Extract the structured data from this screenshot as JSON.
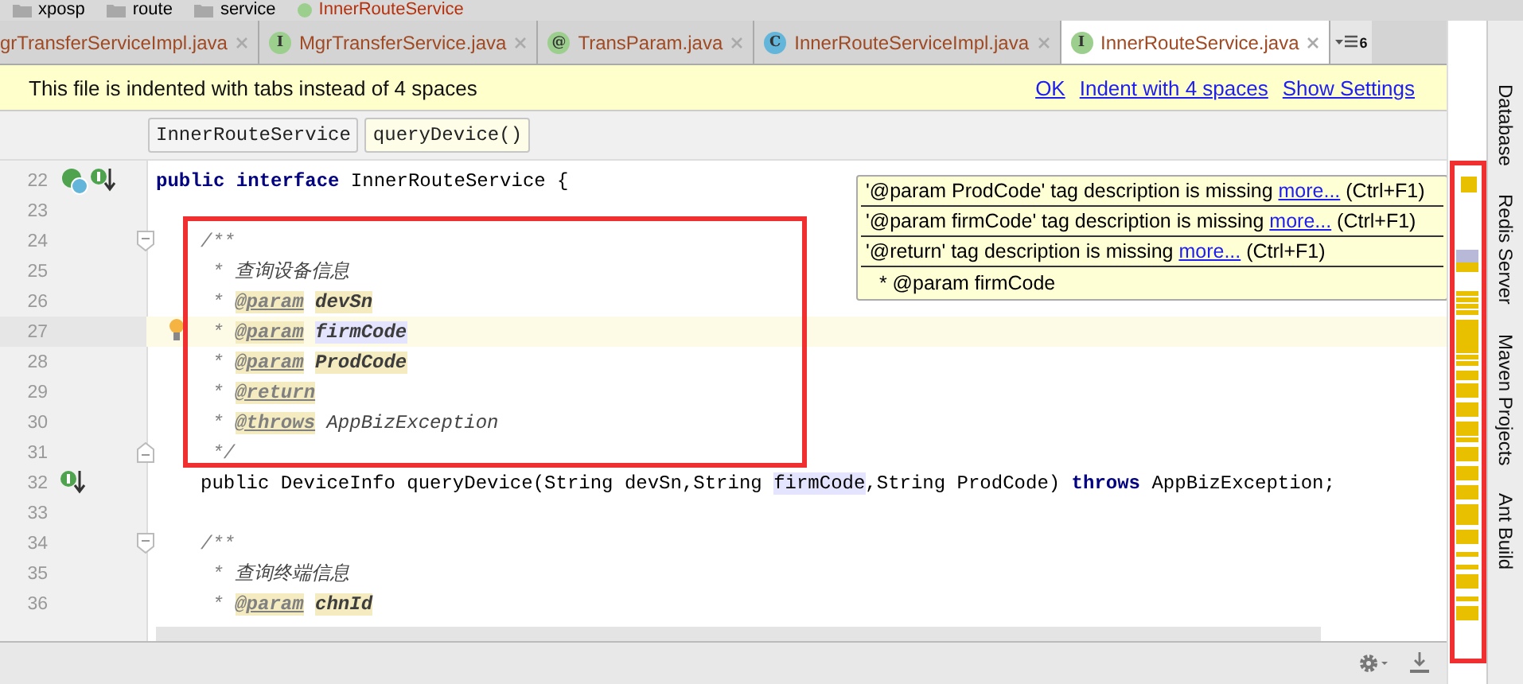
{
  "navigation_bar": {
    "items": [
      {
        "label": "xposp",
        "kind": "folder"
      },
      {
        "label": "route",
        "kind": "folder"
      },
      {
        "label": "service",
        "kind": "folder"
      },
      {
        "label": "InnerRouteService",
        "kind": "interface"
      }
    ]
  },
  "tabs": [
    {
      "label": "grTransferServiceImpl.java",
      "selected": false
    },
    {
      "label": "MgrTransferService.java",
      "kind": "interface",
      "icon_text": "I",
      "selected": false
    },
    {
      "label": "TransParam.java",
      "kind": "annotation",
      "icon_text": "@",
      "selected": false
    },
    {
      "label": "InnerRouteServiceImpl.java",
      "kind": "class",
      "icon_text": "C",
      "selected": false
    },
    {
      "label": "InnerRouteService.java",
      "kind": "interface",
      "icon_text": "I",
      "selected": true
    }
  ],
  "tab_overflow": {
    "count": "6"
  },
  "notification": {
    "message": "This file is indented with tabs instead of 4 spaces",
    "actions": [
      "OK",
      "Indent with 4 spaces",
      "Show Settings"
    ]
  },
  "breadcrumbs": [
    {
      "label": "InnerRouteService",
      "selected": false
    },
    {
      "label": "queryDevice()",
      "selected": true
    }
  ],
  "editor": {
    "lines": [
      {
        "number": "22",
        "gutter": [
          {
            "kind": "implemented"
          },
          {
            "kind": "overriding"
          }
        ],
        "current": false,
        "tokens": [
          {
            "t": "public ",
            "kind": "keyword"
          },
          {
            "t": "interface",
            "kind": "keyword"
          },
          {
            "t": " InnerRouteService {",
            "kind": "plain"
          }
        ],
        "children": [
          {
            "number": "23",
            "current": false
          },
          {
            "kind": "block",
            "outlined": true,
            "lines": [
              {
                "number": "24",
                "fold_start": true,
                "current": false,
                "tokens": [
                  {
                    "t": "/**",
                    "kind": "comment"
                  }
                ]
              },
              {
                "number": "25",
                "current": false,
                "tokens": [
                  {
                    "t": " * ",
                    "kind": "comment"
                  },
                  {
                    "t": "查询设备信息",
                    "kind": "doc"
                  }
                ]
              },
              {
                "number": "26",
                "current": false,
                "tokens": [
                  {
                    "t": " * ",
                    "kind": "comment"
                  },
                  {
                    "t": "@param",
                    "kind": "tag"
                  },
                  {
                    "t": "devSn",
                    "kind": "param"
                  }
                ]
              },
              {
                "number": "27",
                "gutter": [
                  {
                    "kind": "bulb"
                  }
                ],
                "current": true,
                "tokens": [
                  {
                    "t": " * ",
                    "kind": "comment"
                  },
                  {
                    "t": "@param",
                    "kind": "tag"
                  },
                  {
                    "t": "firmCode",
                    "kind": "param-selected"
                  }
                ]
              },
              {
                "number": "28",
                "current": false,
                "tokens": [
                  {
                    "t": " * ",
                    "kind": "comment"
                  },
                  {
                    "t": "@param",
                    "kind": "tag"
                  },
                  {
                    "t": "ProdCode",
                    "kind": "param"
                  }
                ]
              },
              {
                "number": "29",
                "current": false,
                "tokens": [
                  {
                    "t": " * ",
                    "kind": "comment"
                  },
                  {
                    "t": "@return",
                    "kind": "tag"
                  }
                ]
              },
              {
                "number": "30",
                "current": false,
                "tokens": [
                  {
                    "t": " * ",
                    "kind": "comment"
                  },
                  {
                    "t": "@throws",
                    "kind": "tag"
                  },
                  {
                    "t": " AppBizException",
                    "kind": "doc"
                  }
                ]
              },
              {
                "number": "31",
                "fold_end": true,
                "current": false,
                "tokens": [
                  {
                    "t": " */",
                    "kind": "comment"
                  }
                ]
              }
            ]
          },
          {
            "number": "32",
            "gutter": [
              {
                "kind": "overriding"
              }
            ],
            "current": false,
            "tokens": [
              {
                "t": "public DeviceInfo queryDevice(String devSn,String ",
                "kind": "plain"
              },
              {
                "t": "firmCode",
                "kind": "usage"
              },
              {
                "t": ",String ProdCode) ",
                "kind": "plain"
              },
              {
                "t": "throws",
                "kind": "keyword"
              },
              {
                "t": " AppBizException;",
                "kind": "plain"
              }
            ]
          },
          {
            "number": "33",
            "current": false
          },
          {
            "number": "34",
            "fold_start": true,
            "current": false,
            "tokens": [
              {
                "t": "/**",
                "kind": "comment"
              }
            ]
          },
          {
            "number": "35",
            "current": false,
            "tokens": [
              {
                "t": " * ",
                "kind": "comment"
              },
              {
                "t": "查询终端信息",
                "kind": "doc"
              }
            ]
          },
          {
            "number": "36",
            "current": false,
            "tokens": [
              {
                "t": " * ",
                "kind": "comment"
              },
              {
                "t": "@param",
                "kind": "tag"
              },
              {
                "t": "chnId",
                "kind": "param"
              }
            ]
          }
        ]
      }
    ]
  },
  "tooltip": {
    "problems": [
      {
        "message": "'@param ProdCode' tag description is missing",
        "link": "more...",
        "shortcut": "(Ctrl+F1)"
      },
      {
        "message": "'@param firmCode' tag description is missing",
        "link": "more...",
        "shortcut": "(Ctrl+F1)"
      },
      {
        "message": "'@return' tag description is missing",
        "link": "more...",
        "shortcut": "(Ctrl+F1)"
      }
    ],
    "preview": " * @param firmCode"
  },
  "error_stripe": {
    "outlined": true
  },
  "tool_windows": [
    "Database",
    "Redis Server",
    "Maven Projects",
    "Ant Build"
  ]
}
